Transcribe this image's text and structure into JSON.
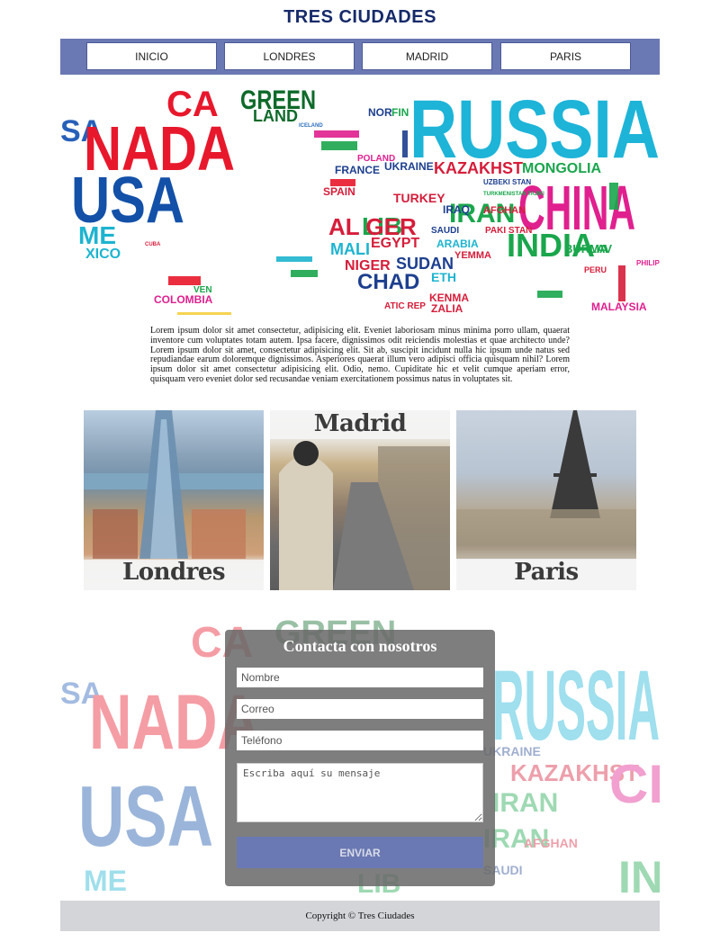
{
  "site_title": "TRES CIUDADES",
  "nav": {
    "items": [
      {
        "label": "INICIO"
      },
      {
        "label": "LONDRES"
      },
      {
        "label": "MADRID"
      },
      {
        "label": "PARIS"
      }
    ],
    "bar_color": "#6a79b3"
  },
  "map_words": {
    "ca": "CA",
    "sa": "SA",
    "nada": "NADA",
    "usa": "USA",
    "me": "ME",
    "xico": "XICO",
    "green": "GREEN",
    "land": "LAND",
    "iceland": "ICELAND",
    "russia": "RUSSIA",
    "china": "CHINA",
    "kazakhst": "KAZAKHST",
    "mongolia": "MONGOLIA",
    "ukraine": "UKRAINE",
    "turkey": "TURKEY",
    "iran": "IRAN",
    "afghan": "AFGHAN",
    "pakistan": "PAKI STAN",
    "india": "INDIA",
    "arabia": "ARABIA",
    "yemen": "YEMMA",
    "sudan": "SUDAN",
    "egypt": "EGYPT",
    "libya": "LIB",
    "algeria": "AL GER",
    "mali": "MALI",
    "niger": "NIGER",
    "chad": "CHAD",
    "eth": "ETH",
    "kenya": "KENMA",
    "malaysia": "MALAYSIA",
    "burma": "BURMA",
    "lav": "LAV",
    "peru": "PERU",
    "colombia": "COLOMBIA",
    "ven": "VEN",
    "cuba": "CUBA",
    "spain": "SPAIN",
    "france": "FRANCE",
    "norway": "NOR",
    "finland": "FIN",
    "poland": "POLAND",
    "uzbeki": "UZBEKI STAN",
    "tajiki": "TURKMENISTAN TAJIKI",
    "iraq": "IRAQ",
    "saudi": "SAUDI",
    "atic": "ATIC REP",
    "zalia": "ZALIA",
    "philippines": "PHILIP PINES"
  },
  "intro_text": "Lorem ipsum dolor sit amet consectetur, adipisicing elit. Eveniet laboriosam minus minima porro ullam, quaerat inventore cum voluptates totam autem. Ipsa facere, dignissimos odit reiciendis molestias et quae architecto unde? Lorem ipsum dolor sit amet, consectetur adipisicing elit. Sit ab, suscipit incidunt nulla hic ipsum unde natus sed repudiandae earum doloremque dignissimos. Asperiores quaerat illum vero adipisci officia quisquam nihil? Lorem ipsum dolor sit amet consectetur adipisicing elit. Odio, nemo. Cupiditate hic et velit cumque aperiam error, quisquam vero eveniet dolor sed recusandae veniam exercitationem possimus natus in voluptates sit.",
  "cities": [
    {
      "label": "Londres"
    },
    {
      "label": "Madrid"
    },
    {
      "label": "Paris"
    }
  ],
  "contact": {
    "title": "Contacta con nosotros",
    "name_placeholder": "Nombre",
    "email_placeholder": "Correo",
    "phone_placeholder": "Teléfono",
    "message_placeholder": "Escriba aquí su mensaje",
    "send_label": "ENVIAR"
  },
  "footer": {
    "text": "Copyright © Tres Ciudades"
  }
}
